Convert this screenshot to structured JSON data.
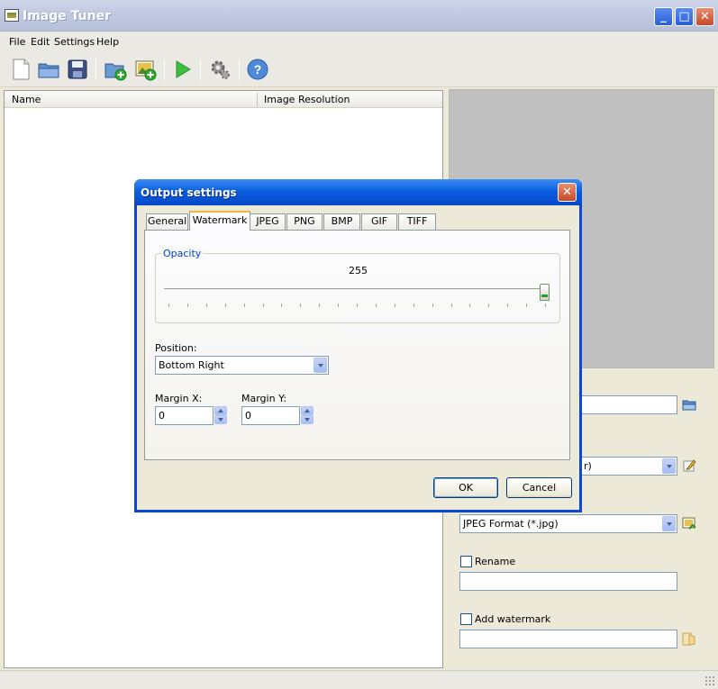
{
  "window": {
    "title": "Image Tuner"
  },
  "menu": [
    "File",
    "Edit",
    "Settings",
    "Help"
  ],
  "toolbar": {
    "buttons": [
      "new-file-icon",
      "open-folder-icon",
      "save-icon",
      "add-folder-icon",
      "add-image-icon",
      "run-icon",
      "settings-gear-icon",
      "help-icon"
    ]
  },
  "list": {
    "columns": [
      "Name",
      "Image Resolution"
    ]
  },
  "right_panel": {
    "format_partial_text": "r)",
    "output_format": "JPEG Format (*.jpg)",
    "rename_label": "Rename",
    "rename_value": "",
    "watermark_label": "Add watermark",
    "watermark_value": ""
  },
  "dialog": {
    "title": "Output settings",
    "tabs": [
      "General",
      "Watermark",
      "JPEG",
      "PNG",
      "BMP",
      "GIF",
      "TIFF"
    ],
    "active_tab": "Watermark",
    "opacity": {
      "legend": "Opacity",
      "value_text": "255",
      "value": 255,
      "max": 255
    },
    "position": {
      "label": "Position:",
      "selected": "Bottom Right"
    },
    "margin_x": {
      "label": "Margin X:",
      "value": "0"
    },
    "margin_y": {
      "label": "Margin Y:",
      "value": "0"
    },
    "ok_label": "OK",
    "cancel_label": "Cancel"
  },
  "colors": {
    "dialog_title": "#0a5fe0",
    "accent_legend": "#0046d5",
    "preview_bg": "#c0c0c0"
  }
}
